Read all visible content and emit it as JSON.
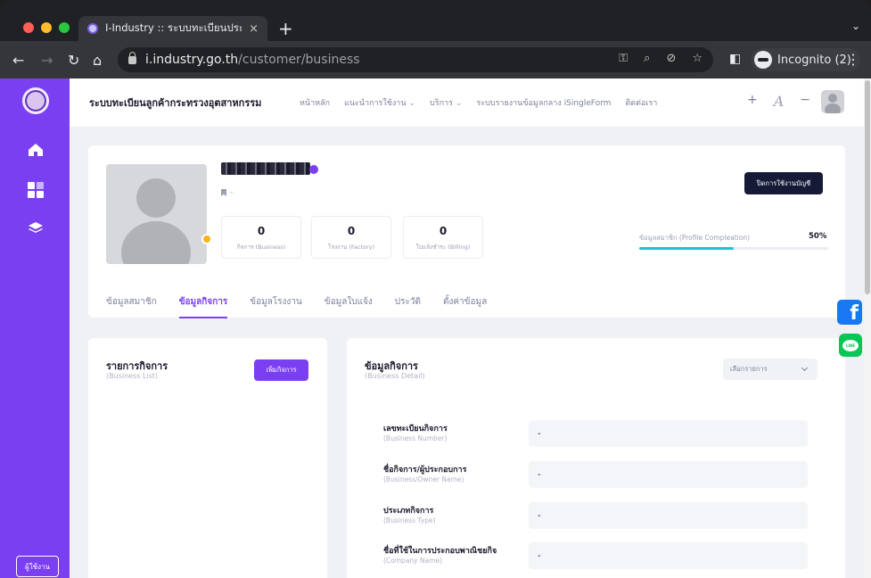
{
  "browser": {
    "tab_title": "I-Industry :: ระบบทะเบียนประวัติ",
    "tab_close": "×",
    "new_tab": "+",
    "tab_menu": "⌄",
    "url_host": "i.industry.go.th",
    "url_path": "/customer/business",
    "incognito_label": "Incognito (2)",
    "kebab": "⋮"
  },
  "header": {
    "brand": "ระบบทะเบียนลูกค้ากระทรวงอุตสาหกรรม",
    "menu": [
      {
        "label": "หน้าหลัก",
        "caret": ""
      },
      {
        "label": "แนะนำการใช้งาน",
        "caret": "⌄"
      },
      {
        "label": "บริการ",
        "caret": "⌄"
      },
      {
        "label": "ระบบรายงานข้อมูลกลาง iSingleForm",
        "caret": ""
      },
      {
        "label": "ติดต่อเรา",
        "caret": ""
      }
    ],
    "font_plus": "+",
    "font_a": "A",
    "font_minus": "−"
  },
  "sidebar": {
    "bottom_button": "ผู้ใช้งาน"
  },
  "profile": {
    "bookmark_text": "-",
    "stats": [
      {
        "value": "0",
        "label": "กิจการ (Business)"
      },
      {
        "value": "0",
        "label": "โรงงาน (Factory)"
      },
      {
        "value": "0",
        "label": "ใบแจ้งชำระ (Billing)"
      }
    ],
    "deactivate_button": "ปิดการใช้งานบัญชี",
    "completion_label": "ข้อมูลสมาชิก (Profile Compleation)",
    "completion_pct": "50%",
    "completion_value": 0.5,
    "tabs": [
      "ข้อมูลสมาชิก",
      "ข้อมูลกิจการ",
      "ข้อมูลโรงงาน",
      "ข้อมูลใบแจ้ง",
      "ประวัติ",
      "ตั้งค่าข้อมูล"
    ],
    "active_tab": 1
  },
  "business_list": {
    "title": "รายการกิจการ",
    "subtitle": "(Business List)",
    "add_button": "เพิ่มกิจการ"
  },
  "business_detail": {
    "title": "ข้อมูลกิจการ",
    "subtitle": "(Business Detail)",
    "select_placeholder": "เลือกรายการ",
    "fields": [
      {
        "label": "เลขทะเบียนกิจการ",
        "sublabel": "(Business Number)",
        "value": "-"
      },
      {
        "label": "ชื่อกิจการ/ผู้ประกอบการ",
        "sublabel": "(Business/Owner Name)",
        "value": "-"
      },
      {
        "label": "ประเภทกิจการ",
        "sublabel": "(Business Type)",
        "value": "-"
      },
      {
        "label": "ชื่อที่ใช้ในการประกอบพาณิชยกิจ",
        "sublabel": "(Company Name)",
        "value": "-"
      }
    ]
  },
  "social": {
    "facebook": "f",
    "line": "LINE"
  }
}
